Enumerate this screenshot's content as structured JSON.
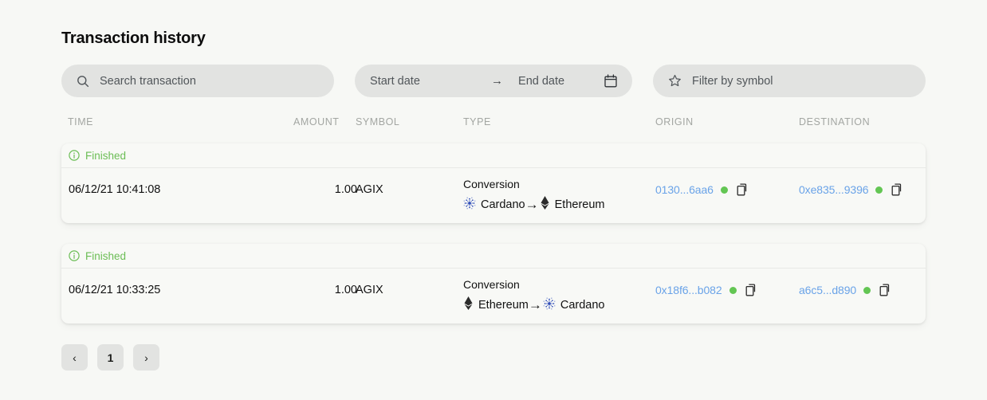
{
  "header": {
    "title": "Transaction history"
  },
  "filters": {
    "search": {
      "placeholder": "Search transaction",
      "value": "",
      "icon": "search-icon"
    },
    "date_range": {
      "start_placeholder": "Start date",
      "separator": "→",
      "end_placeholder": "End date",
      "icon": "calendar-icon"
    },
    "symbol": {
      "placeholder": "Filter by symbol",
      "value": "",
      "icon": "star-icon"
    }
  },
  "table": {
    "columns": [
      "TIME",
      "AMOUNT",
      "SYMBOL",
      "TYPE",
      "ORIGIN",
      "DESTINATION"
    ],
    "rows": [
      {
        "status": "Finished",
        "status_icon": "info-circle-icon",
        "time": "06/12/21 10:41:08",
        "amount": "1.00",
        "symbol": "AGIX",
        "type": "Conversion",
        "from_chain": "Cardano",
        "from_chain_icon": "cardano-icon",
        "to_chain": "Ethereum",
        "to_chain_icon": "ethereum-icon",
        "conversion_arrow": "→",
        "origin": "0130...6aa6",
        "destination": "0xe835...9396",
        "copy_icon": "copy-icon"
      },
      {
        "status": "Finished",
        "status_icon": "info-circle-icon",
        "time": "06/12/21 10:33:25",
        "amount": "1.00",
        "symbol": "AGIX",
        "type": "Conversion",
        "from_chain": "Ethereum",
        "from_chain_icon": "ethereum-icon",
        "to_chain": "Cardano",
        "to_chain_icon": "cardano-icon",
        "conversion_arrow": "→",
        "origin": "0x18f6...b082",
        "destination": "a6c5...d890",
        "copy_icon": "copy-icon"
      }
    ]
  },
  "pagination": {
    "prev_label": "‹",
    "next_label": "›",
    "pages": [
      "1"
    ],
    "current_page": "1"
  },
  "colors": {
    "page_background": "#f7f8f5",
    "card_background": "#f8f9f6",
    "field_background": "#e2e3e1",
    "status_green": "#6bbd55",
    "dot_green": "#63c653",
    "link_blue": "#6aa3e8",
    "header_gray": "#a3a6a2",
    "cardano_blue": "#2f4db8"
  }
}
